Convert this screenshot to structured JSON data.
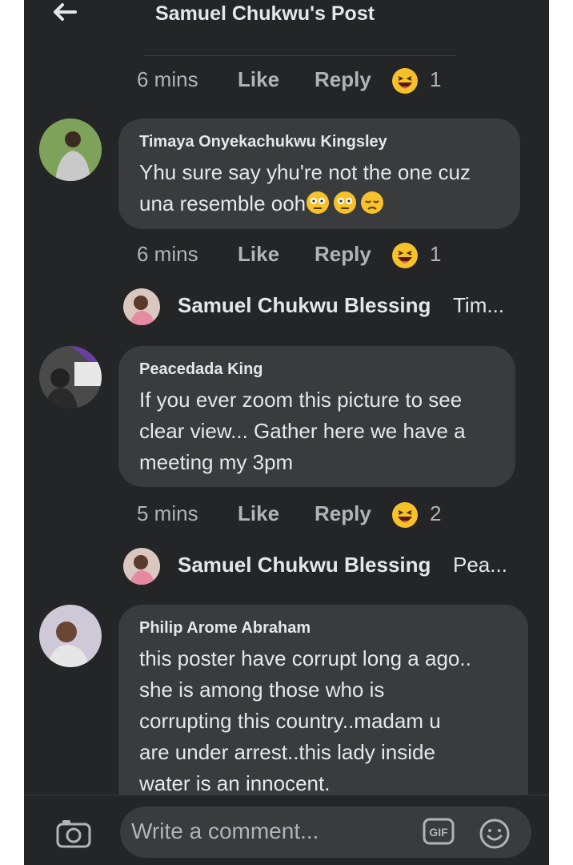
{
  "header": {
    "title": "Samuel Chukwu's Post"
  },
  "first_actions": {
    "time": "6 mins",
    "like": "Like",
    "reply": "Reply",
    "reaction_count": "1"
  },
  "comments": [
    {
      "author": "Timaya Onyekachukwu Kingsley",
      "lines": [
        "Yhu sure say yhu're not the one cuz",
        "una resemble ooh"
      ],
      "actions": {
        "time": "6 mins",
        "like": "Like",
        "reply": "Reply",
        "reaction_count": "1"
      },
      "reply_preview": {
        "name": "Samuel Chukwu Blessing",
        "preview": "Tim..."
      }
    },
    {
      "author": "Peacedada King",
      "lines": [
        "If you ever zoom this picture to see",
        "clear view... Gather here we have a",
        "meeting my 3pm"
      ],
      "actions": {
        "time": "5 mins",
        "like": "Like",
        "reply": "Reply",
        "reaction_count": "2"
      },
      "reply_preview": {
        "name": "Samuel Chukwu Blessing",
        "preview": "Pea..."
      }
    },
    {
      "author": "Philip Arome Abraham",
      "lines": [
        "this poster have corrupt long a ago..",
        "she is among those who is",
        "corrupting this country..madam u",
        "are under arrest..this lady inside",
        "water is an innocent."
      ]
    }
  ],
  "composer": {
    "placeholder": "Write a comment...",
    "gif_label": "GIF"
  },
  "colors": {
    "background": "#242526",
    "bubble": "#3a3b3c",
    "text": "#e4e6eb",
    "muted": "#b0b3b8",
    "emoji": "#f7c229"
  },
  "icons": [
    "back-arrow-icon",
    "laugh-reaction-icon",
    "camera-icon",
    "gif-icon",
    "smiley-icon",
    "flushed-emoji-icon",
    "pensive-emoji-icon"
  ]
}
